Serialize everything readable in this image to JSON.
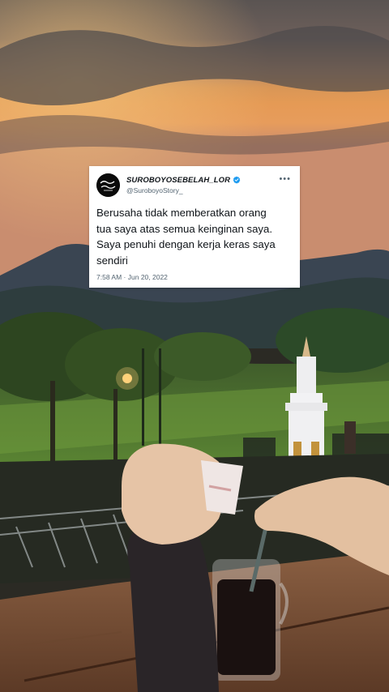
{
  "tweet": {
    "display_name": "SUROBOYOSEBELAH_LOR",
    "handle": "@SuroboyoStory_",
    "text": "Berusaha tidak memberatkan orang\ntua saya atas semua keinginan saya.\nSaya penuhi dengan kerja keras saya\nsendiri",
    "time": "7:58 AM",
    "separator": " · ",
    "date": "Jun 20, 2022",
    "avatar_text": "Suroboyo Sebelah",
    "verified_color": "#1d9bf0"
  },
  "icons": {
    "more": "more-horizontal-icon",
    "verified": "verified-badge-icon"
  }
}
